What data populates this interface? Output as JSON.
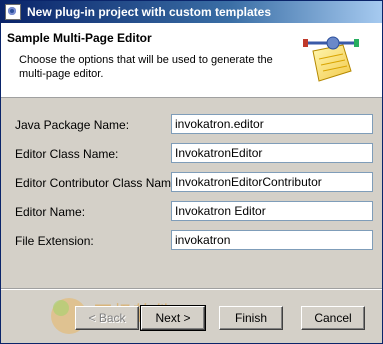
{
  "window": {
    "title": "New plug-in project with custom templates"
  },
  "header": {
    "title": "Sample Multi-Page Editor",
    "description": "Choose the options that will be used to generate the multi-page editor."
  },
  "fields": [
    {
      "label": "Java Package Name:",
      "value": "invokatron.editor"
    },
    {
      "label": "Editor Class Name:",
      "value": "InvokatronEditor"
    },
    {
      "label": "Editor Contributor Class Name:",
      "value": "InvokatronEditorContributor"
    },
    {
      "label": "Editor Name:",
      "value": "Invokatron Editor"
    },
    {
      "label": "File Extension:",
      "value": "invokatron"
    }
  ],
  "buttons": {
    "back": "< Back",
    "next": "Next >",
    "finish": "Finish",
    "cancel": "Cancel"
  },
  "watermark": {
    "text": "天极软件"
  },
  "icons": {
    "title": "eclipse-plugin-icon",
    "header": "editor-wizard-icon"
  },
  "colors": {
    "titlebar_start": "#0a246a",
    "titlebar_end": "#a6caf0",
    "dialog_bg": "#d4d0c8"
  }
}
